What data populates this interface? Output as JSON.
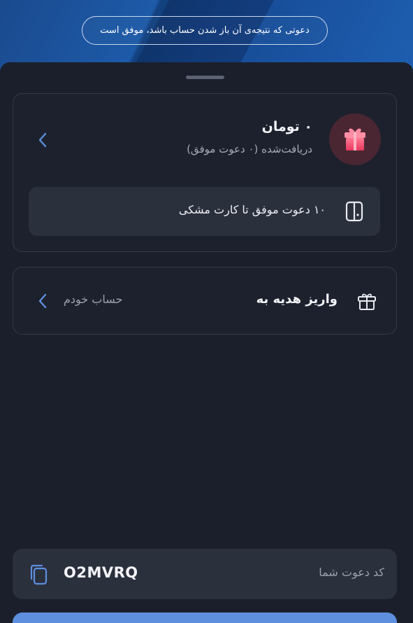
{
  "hero": {
    "notice": "دعوتی که نتیجه‌ی آن باز شدن حساب باشد، موفق است"
  },
  "reward_card": {
    "amount": "۰ تومان",
    "subtitle": "دریافت‌شده (۰ دعوت موفق)",
    "avatar_icon": "gift-box-icon",
    "progress_text": "۱۰ دعوت موفق تا کارت مشکی",
    "progress_icon": "card-icon"
  },
  "gift_card": {
    "title": "واریز هدیه به",
    "target": "حساب خودم",
    "icon": "gift-icon"
  },
  "invite_code": {
    "label": "کد دعوت شما",
    "value": "O2MVRQ",
    "icon": "copy-icon"
  },
  "colors": {
    "background": "#1b1f2b",
    "accent": "#5d8fde",
    "gift_pink": "#e94b6d"
  }
}
